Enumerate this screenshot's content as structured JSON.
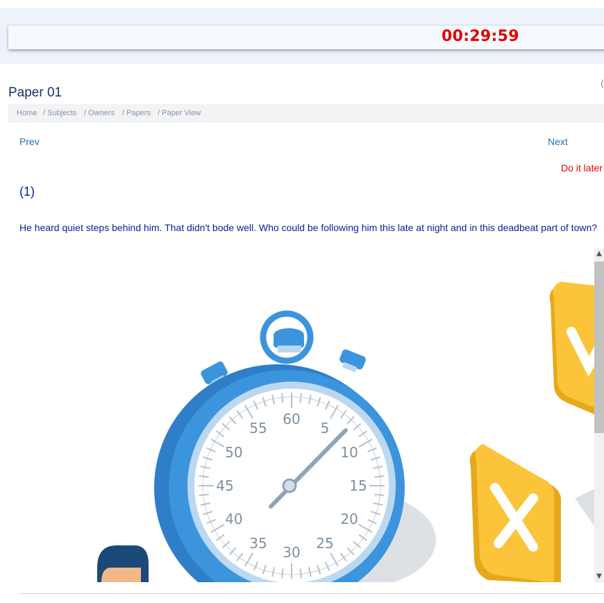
{
  "timer": {
    "text": "00:29:59",
    "color": "#e60000"
  },
  "page": {
    "title": "Paper 01",
    "corner_glyph": "("
  },
  "breadcrumb": {
    "items": [
      "Home",
      "/ Subjects",
      "/ Owners",
      "/ Papers",
      "/ Paper View"
    ]
  },
  "nav": {
    "prev_label": "Prev",
    "next_label": "Next",
    "later_label": "Do it later"
  },
  "question": {
    "number": "(1)",
    "text": "He heard quiet steps behind him. That didn't bode well. Who could be following him this late at night and in this deadbeat part of town?",
    "image_icon": "stopwatch-illustration"
  },
  "stopwatch": {
    "dial_numbers": [
      "60",
      "5",
      "10",
      "15",
      "20",
      "25",
      "30",
      "35",
      "40",
      "45",
      "50",
      "55"
    ]
  },
  "colors": {
    "accent_blue": "#1f6fc4",
    "text_navy": "#0a1f8f",
    "stopwatch_blue": "#3c95dc",
    "badge_yellow": "#fbc43a"
  }
}
